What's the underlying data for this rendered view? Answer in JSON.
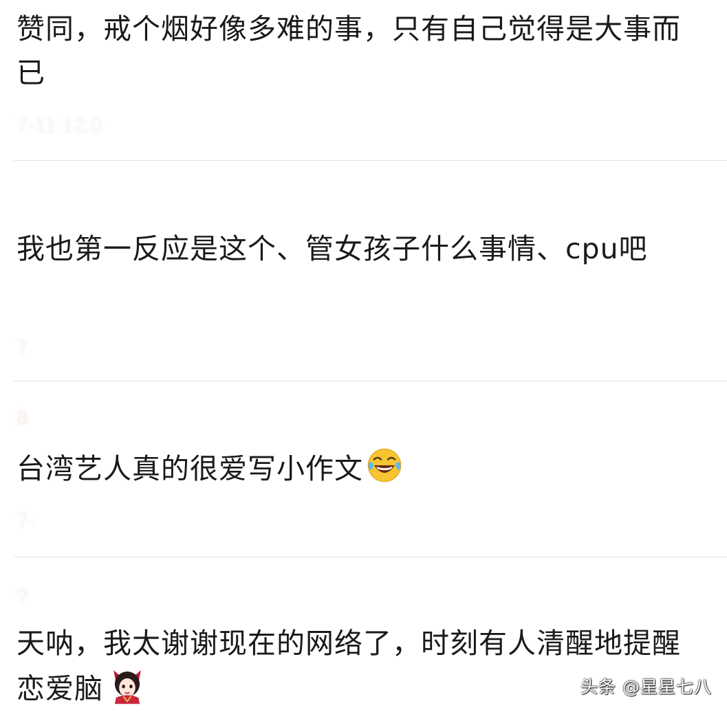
{
  "comments": [
    {
      "text": "赞同，戒个烟好像多难的事，只有自己觉得是大事而已",
      "meta": "7-11 12:0"
    },
    {
      "text": "我也第一反应是这个、管女孩子什么事情、cpu吧",
      "meta": "7"
    },
    {
      "header": "8",
      "text": "台湾艺人真的很爱写小作文",
      "emoji": "laughing-tears-icon",
      "meta": "7-"
    },
    {
      "header": "?",
      "text": "天呐，我太谢谢现在的网络了，时刻有人清醒地提醒恋爱脑",
      "emoji": "avatar-sticker-icon"
    }
  ],
  "watermark": "头条 @星星七八",
  "colors": {
    "text": "#1a1a1a",
    "divider": "#e3e3e3",
    "faded_meta": "#f0f0f0",
    "emoji_yellow": "#f7c531"
  }
}
